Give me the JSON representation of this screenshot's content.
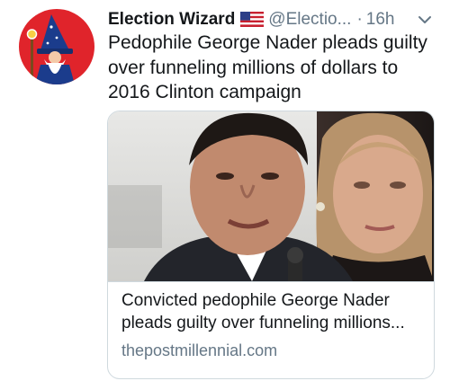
{
  "tweet": {
    "author_name": "Election Wizard",
    "flag_icon": "us-flag-icon",
    "handle": "@Electio...",
    "separator": "·",
    "time": "16h",
    "menu_icon": "chevron-down-icon",
    "text_lines": [
      "Pedophile George Nader pleads guilty",
      "over funneling millions of dollars to",
      "2016 Clinton campaign"
    ],
    "avatar_icon": "wizard-avatar-icon"
  },
  "card": {
    "image": "news-photo",
    "title_lines": [
      "Convicted pedophile George Nader",
      "pleads guilty over funneling millions..."
    ],
    "domain": "thepostmillennial.com"
  },
  "colors": {
    "avatar_bg": "#e0242b",
    "secondary_text": "#657786",
    "border": "#cfd9de"
  }
}
